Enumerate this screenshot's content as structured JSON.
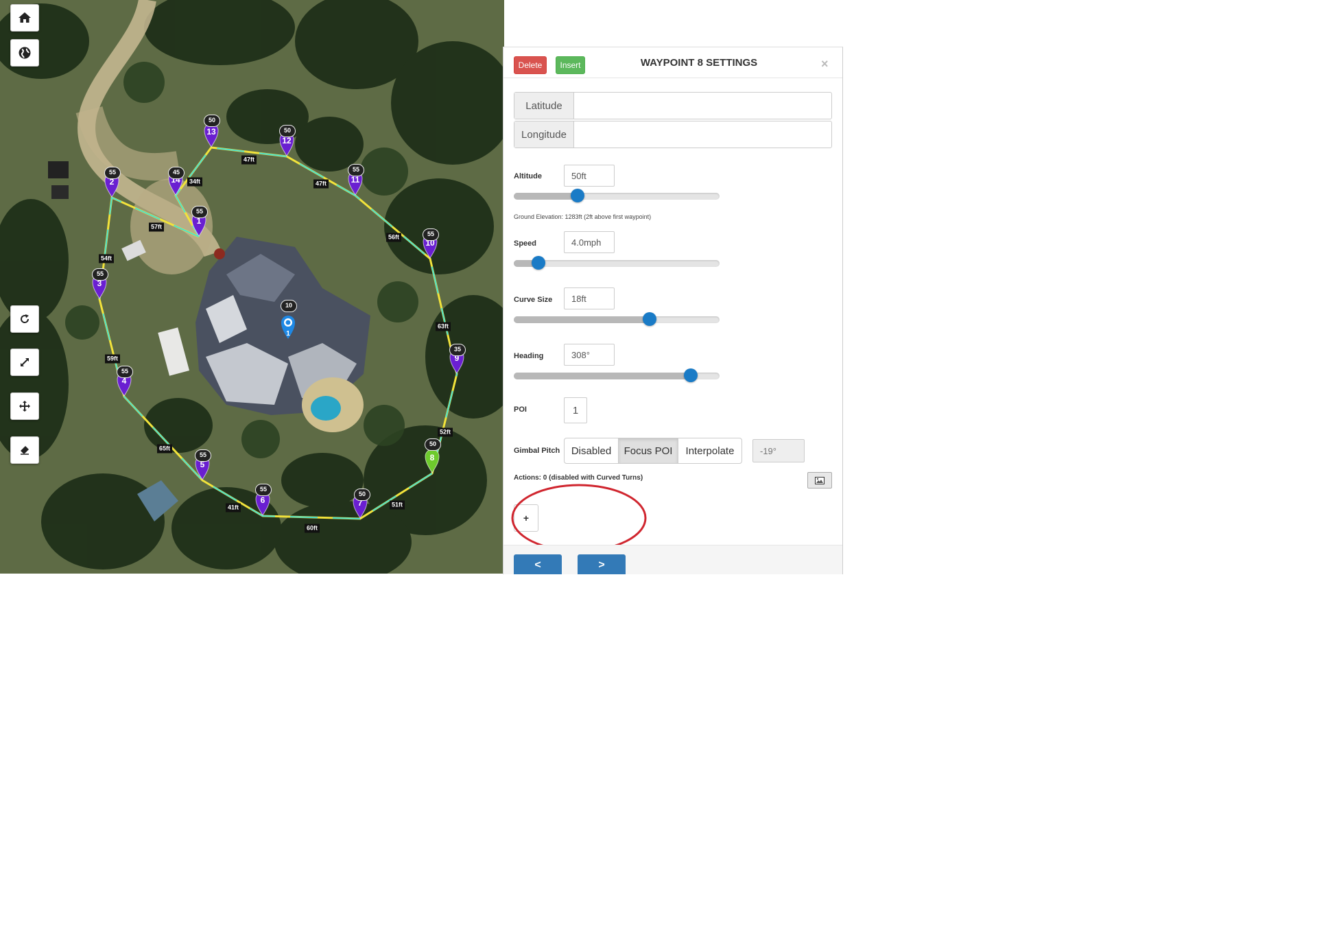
{
  "map": {
    "controls": [
      {
        "name": "home-icon"
      },
      {
        "name": "globe-icon"
      },
      {
        "name": "refresh-icon"
      },
      {
        "name": "expand-icon"
      },
      {
        "name": "move-icon"
      },
      {
        "name": "eraser-icon"
      }
    ],
    "waypoints": [
      {
        "num": "1",
        "alt": "55",
        "color": "#6a1fd1"
      },
      {
        "num": "2",
        "alt": "55",
        "color": "#6a1fd1"
      },
      {
        "num": "3",
        "alt": "55",
        "color": "#6a1fd1"
      },
      {
        "num": "4",
        "alt": "55",
        "color": "#6a1fd1"
      },
      {
        "num": "5",
        "alt": "55",
        "color": "#6a1fd1"
      },
      {
        "num": "6",
        "alt": "55",
        "color": "#6a1fd1"
      },
      {
        "num": "7",
        "alt": "50",
        "color": "#6a1fd1"
      },
      {
        "num": "8",
        "alt": "50",
        "color": "#6ecb2d"
      },
      {
        "num": "9",
        "alt": "35",
        "color": "#6a1fd1"
      },
      {
        "num": "10",
        "alt": "55",
        "color": "#6a1fd1"
      },
      {
        "num": "11",
        "alt": "55",
        "color": "#6a1fd1"
      },
      {
        "num": "12",
        "alt": "50",
        "color": "#6a1fd1"
      },
      {
        "num": "13",
        "alt": "50",
        "color": "#6a1fd1"
      },
      {
        "num": "14",
        "alt": "45",
        "color": "#6a1fd1"
      }
    ],
    "distances": [
      "57ft",
      "54ft",
      "59ft",
      "65ft",
      "41ft",
      "60ft",
      "51ft",
      "52ft",
      "63ft",
      "56ft",
      "47ft",
      "47ft",
      "34ft"
    ],
    "poi": {
      "num": "1",
      "alt": "10",
      "color": "#1e88e5"
    }
  },
  "panel": {
    "delete_label": "Delete",
    "insert_label": "Insert",
    "title": "WAYPOINT 8 SETTINGS",
    "close_label": "×",
    "latitude_label": "Latitude",
    "latitude_value": "",
    "longitude_label": "Longitude",
    "longitude_value": "",
    "altitude": {
      "label": "Altitude",
      "value": "50ft",
      "slider_fraction": 0.31
    },
    "ground_elevation": "Ground Elevation: 1283ft (2ft above first waypoint)",
    "speed": {
      "label": "Speed",
      "value": "4.0mph",
      "slider_fraction": 0.12
    },
    "curve_size": {
      "label": "Curve Size",
      "value": "18ft",
      "slider_fraction": 0.66
    },
    "heading": {
      "label": "Heading",
      "value": "308°",
      "slider_fraction": 0.86
    },
    "poi": {
      "label": "POI",
      "value": "1"
    },
    "gimbal": {
      "label": "Gimbal Pitch",
      "options": [
        "Disabled",
        "Focus POI",
        "Interpolate"
      ],
      "selected": "Focus POI",
      "value": "-19°"
    },
    "actions_label": "Actions: 0 (disabled with Curved Turns)",
    "add_action_label": "+",
    "prev_label": "<",
    "next_label": ">",
    "highlight_color": "#d0262f"
  }
}
